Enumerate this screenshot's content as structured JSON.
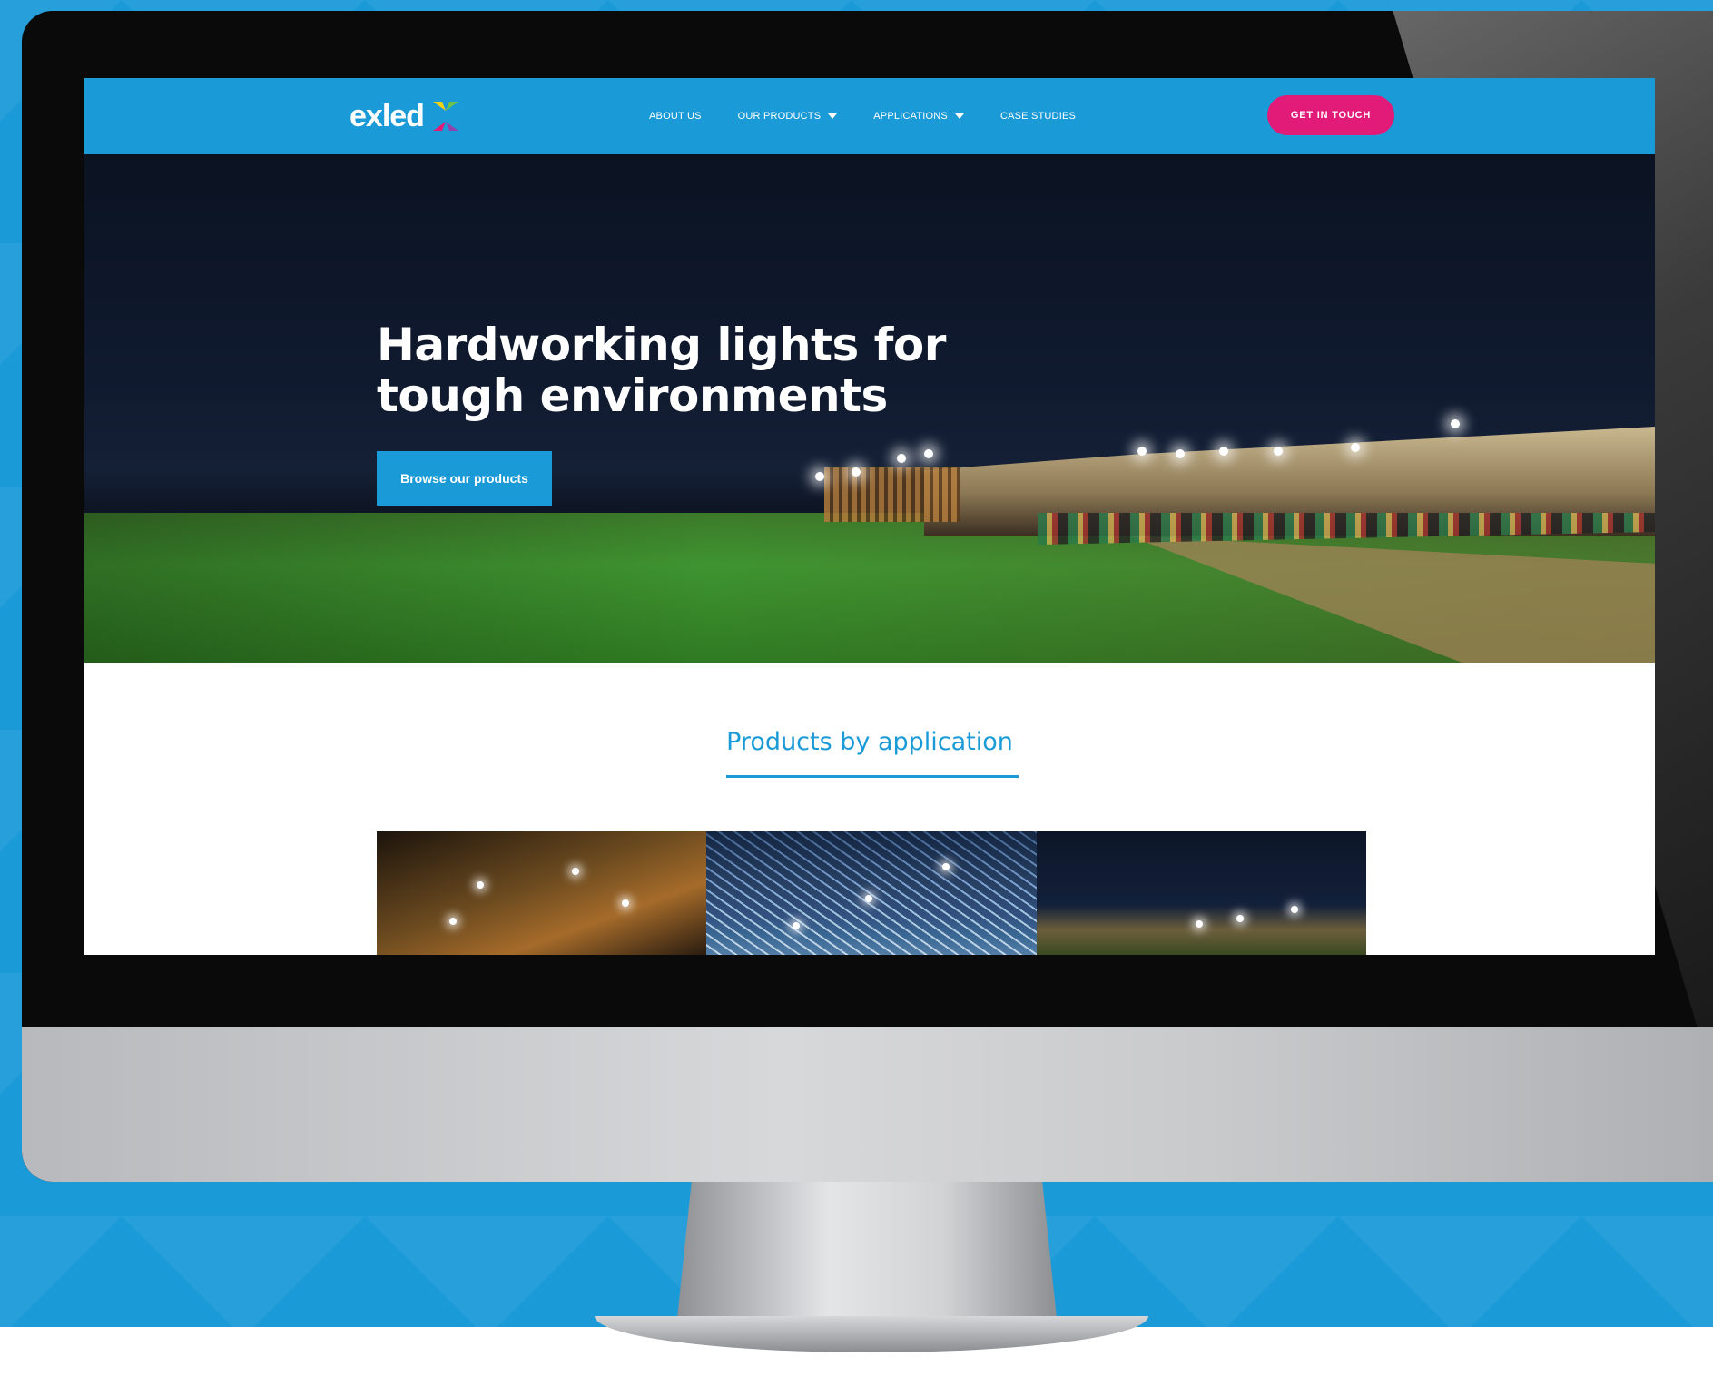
{
  "site": {
    "logo_text": "exled",
    "nav": {
      "items": [
        {
          "label": "ABOUT US",
          "has_dropdown": false
        },
        {
          "label": "OUR PRODUCTS",
          "has_dropdown": true
        },
        {
          "label": "APPLICATIONS",
          "has_dropdown": true
        },
        {
          "label": "CASE STUDIES",
          "has_dropdown": false
        }
      ],
      "cta_label": "GET IN TOUCH"
    },
    "hero": {
      "title_line1": "Hardworking lights for",
      "title_line2": "tough environments",
      "button_label": "Browse our products"
    },
    "products": {
      "heading": "Products by application",
      "tiles": [
        {
          "name": "tile-1"
        },
        {
          "name": "tile-2"
        },
        {
          "name": "tile-3"
        }
      ]
    }
  },
  "colors": {
    "brand_blue": "#1a9ad7",
    "cta_pink": "#e21a78",
    "backdrop_blue": "#1b9ad8"
  },
  "icons": {
    "logo_mark": "exled-x-logo-icon",
    "dropdown": "chevron-down-icon"
  }
}
